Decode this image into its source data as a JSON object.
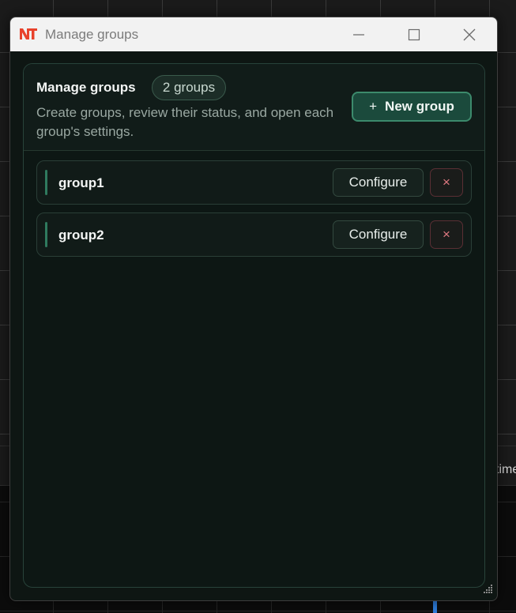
{
  "background": {
    "time_label": "time"
  },
  "window": {
    "title": "Manage groups",
    "icons": {
      "app": "nt-logo-icon",
      "minimize": "minimize-icon",
      "maximize": "maximize-icon",
      "close": "close-icon"
    }
  },
  "header": {
    "title": "Manage groups",
    "badge": "2 groups",
    "description": "Create groups, review their status, and open each group's settings.",
    "new_group_plus": "+",
    "new_group_label": "New group"
  },
  "groups": [
    {
      "name": "group1",
      "configure_label": "Configure",
      "delete_label": "×"
    },
    {
      "name": "group2",
      "configure_label": "Configure",
      "delete_label": "×"
    }
  ],
  "colors": {
    "accent": "#2f7a5e",
    "primary_button": "#1b4a3c",
    "danger": "#e07a82",
    "app_icon": "#e8422c"
  }
}
